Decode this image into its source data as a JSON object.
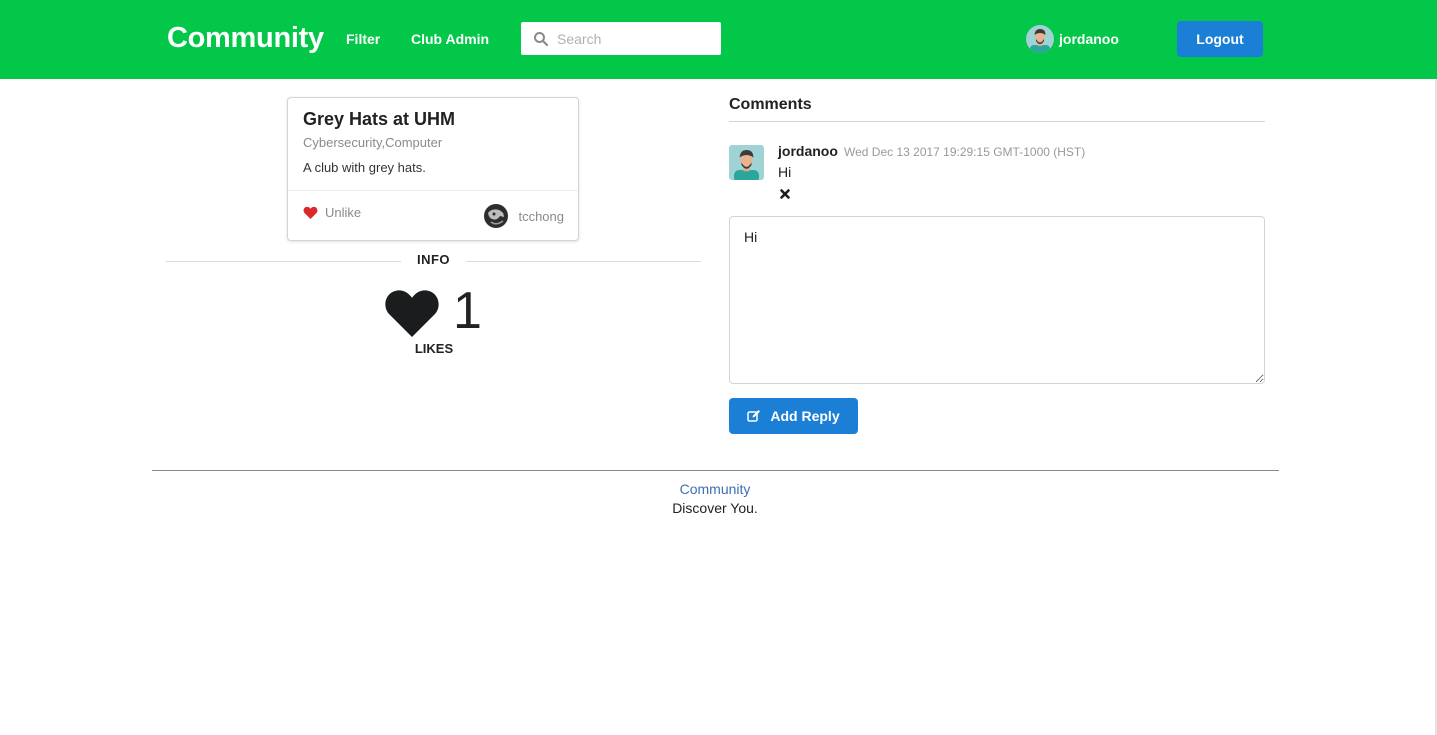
{
  "header": {
    "brand": "Community",
    "nav": [
      {
        "label": "Filter"
      },
      {
        "label": "Club Admin"
      }
    ],
    "search": {
      "placeholder": "Search",
      "value": ""
    },
    "user": {
      "name": "jordanoo"
    },
    "logout_label": "Logout",
    "colors": {
      "bar": "#02c748",
      "button": "#1b7fd6"
    }
  },
  "club_card": {
    "title": "Grey Hats at UHM",
    "categories": "Cybersecurity,Computer",
    "description": "A club with grey hats.",
    "unlike_label": "Unlike",
    "owner": "tcchong"
  },
  "info": {
    "label": "INFO",
    "likes_count": "1",
    "likes_label": "LIKES"
  },
  "comments": {
    "header": "Comments",
    "items": [
      {
        "author": "jordanoo",
        "date": "Wed Dec 13 2017 19:29:15 GMT-1000 (HST)",
        "text": "Hi"
      }
    ],
    "reply_value": "Hi",
    "add_reply_label": "Add Reply"
  },
  "footer": {
    "link": "Community",
    "tagline": "Discover You."
  }
}
